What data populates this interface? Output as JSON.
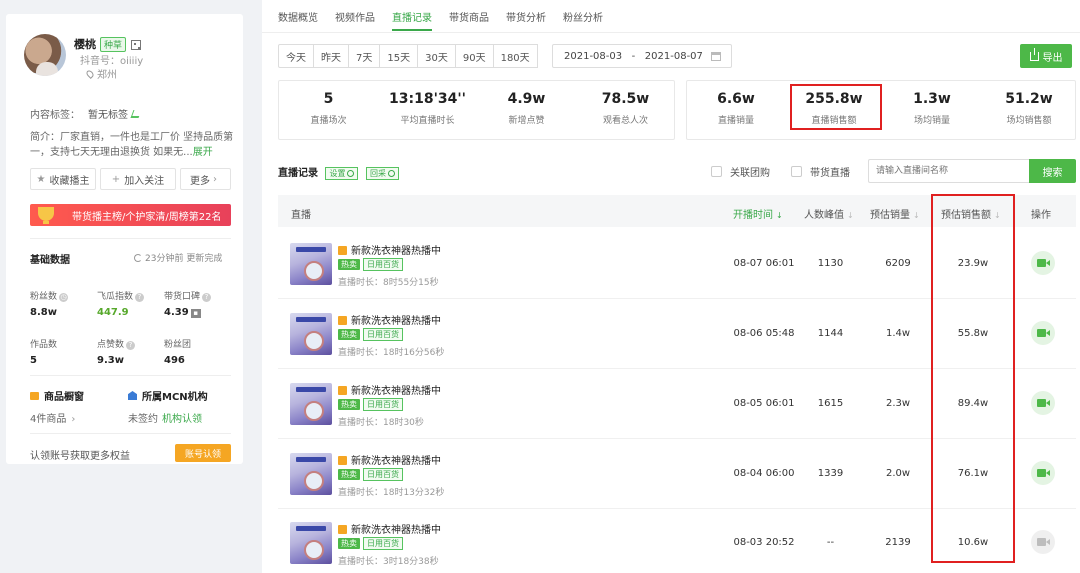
{
  "profile": {
    "name": "樱桃",
    "badge": "种草",
    "douyin_id": "抖音号：oiiiiy",
    "location": "郑州",
    "content_tag_label": "内容标签：",
    "content_tag_value": "暂无标签",
    "intro": "简介：厂家直销，一件也是工厂价 坚持品质第一，支持七天无理由退换货 如果无...",
    "expand": "展开",
    "buttons": {
      "favorite": "收藏播主",
      "follow": "加入关注",
      "more": "更多"
    },
    "rank_banner": "带货播主榜/个护家清/周榜第22名",
    "basic_data_title": "基础数据",
    "updated": "23分钟前  更新完成",
    "stats": [
      {
        "label": "粉丝数",
        "value": "8.8w"
      },
      {
        "label": "飞瓜指数",
        "value": "447.9"
      },
      {
        "label": "带货口碑",
        "value": "4.39"
      },
      {
        "label": "作品数",
        "value": "5"
      },
      {
        "label": "点赞数",
        "value": "9.3w"
      },
      {
        "label": "粉丝团",
        "value": "496"
      }
    ],
    "shop_title": "商品橱窗",
    "shop_sub": "4件商品",
    "mcn_title": "所属MCN机构",
    "mcn_sub": "未签约",
    "mcn_link": "机构认领",
    "claim_text": "认领账号获取更多权益",
    "claim_btn": "账号认领"
  },
  "tabs": [
    "数据概览",
    "视频作品",
    "直播记录",
    "带货商品",
    "带货分析",
    "粉丝分析"
  ],
  "active_tab": "直播记录",
  "date_buttons": [
    "今天",
    "昨天",
    "7天",
    "15天",
    "30天",
    "90天",
    "180天"
  ],
  "date_range": "2021-08-03   -   2021-08-07",
  "export_label": "导出",
  "summary_left": [
    {
      "value": "5",
      "label": "直播场次"
    },
    {
      "value": "13:18'34''",
      "label": "平均直播时长"
    },
    {
      "value": "4.9w",
      "label": "新增点赞"
    },
    {
      "value": "78.5w",
      "label": "观看总人次"
    }
  ],
  "summary_right": [
    {
      "value": "6.6w",
      "label": "直播销量"
    },
    {
      "value": "255.8w",
      "label": "直播销售额"
    },
    {
      "value": "1.3w",
      "label": "场均销量"
    },
    {
      "value": "51.2w",
      "label": "场均销售额"
    }
  ],
  "records": {
    "title": "直播记录",
    "settings_tag": "设置",
    "review_tag": "回采",
    "filter_group": "关联团购",
    "filter_live": "带货直播",
    "search_placeholder": "请输入直播间名称",
    "search_btn": "搜索",
    "headers": {
      "live": "直播",
      "start": "开播时间",
      "peak": "人数峰值",
      "sales": "预估销量",
      "revenue": "预估销售额",
      "action": "操作"
    },
    "rows": [
      {
        "title": "新款洗衣神器热播中",
        "hot": "热卖",
        "cat": "日用百货",
        "duration": "直播时长：8时55分15秒",
        "start": "08-07 06:01",
        "peak": "1130",
        "sales": "6209",
        "revenue": "23.9w"
      },
      {
        "title": "新款洗衣神器热播中",
        "hot": "热卖",
        "cat": "日用百货",
        "duration": "直播时长：18时16分56秒",
        "start": "08-06 05:48",
        "peak": "1144",
        "sales": "1.4w",
        "revenue": "55.8w"
      },
      {
        "title": "新款洗衣神器热播中",
        "hot": "热卖",
        "cat": "日用百货",
        "duration": "直播时长：18时30秒",
        "start": "08-05 06:01",
        "peak": "1615",
        "sales": "2.3w",
        "revenue": "89.4w"
      },
      {
        "title": "新款洗衣神器热播中",
        "hot": "热卖",
        "cat": "日用百货",
        "duration": "直播时长：18时13分32秒",
        "start": "08-04 06:00",
        "peak": "1339",
        "sales": "2.0w",
        "revenue": "76.1w"
      },
      {
        "title": "新款洗衣神器热播中",
        "hot": "热卖",
        "cat": "日用百货",
        "duration": "直播时长：3时18分38秒",
        "start": "08-03 20:52",
        "peak": "--",
        "sales": "2139",
        "revenue": "10.6w"
      }
    ]
  }
}
